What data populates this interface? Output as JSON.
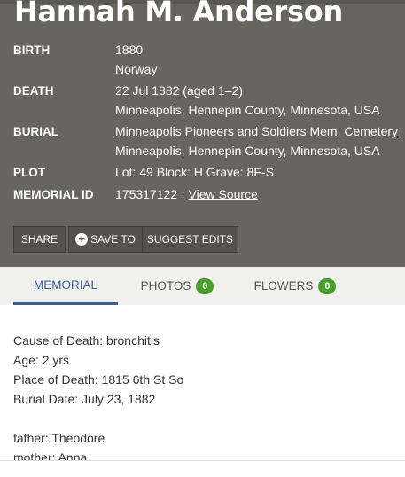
{
  "memorial": {
    "name": "Hannah M. Anderson",
    "birth": {
      "label": "BIRTH",
      "date": "1880",
      "place": "Norway"
    },
    "death": {
      "label": "DEATH",
      "date": "22 Jul 1882 (aged 1–2)",
      "place": "Minneapolis, Hennepin County, Minnesota, USA"
    },
    "burial": {
      "label": "BURIAL",
      "cemetery": "Minneapolis Pioneers and Soldiers Mem. Cemetery",
      "place": "Minneapolis, Hennepin County, Minnesota, USA"
    },
    "plot": {
      "label": "PLOT",
      "value": "Lot: 49 Block: H Grave: 8F-S"
    },
    "memorial_id": {
      "label": "MEMORIAL ID",
      "value": "175317122 ·",
      "link": "View Source"
    }
  },
  "actions": {
    "share": "SHARE",
    "save_to": "SAVE TO",
    "suggest_edits": "SUGGEST EDITS"
  },
  "tabs": [
    {
      "label": "MEMORIAL",
      "active": true
    },
    {
      "label": "PHOTOS",
      "count": "0"
    },
    {
      "label": "FLOWERS",
      "count": "0"
    }
  ],
  "bio": {
    "lines": [
      "Cause of Death: bronchitis",
      "Age: 2 yrs",
      "Place of Death: 1815 6th St So",
      "Burial Date: July 23, 1882",
      "father: Theodore",
      "mother: Anna"
    ]
  },
  "colors": {
    "header_bg": "#686561",
    "tab_active": "#3d5a99",
    "badge": "#4a9f2b"
  }
}
